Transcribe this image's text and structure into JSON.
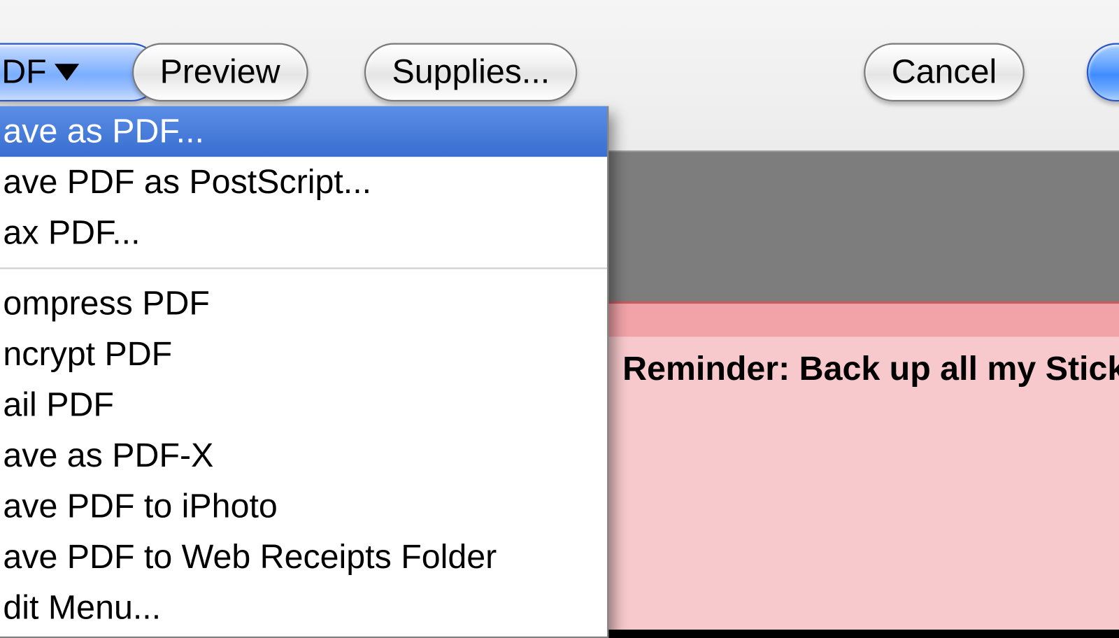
{
  "toolbar": {
    "pdf_label": "DF",
    "preview_label": "Preview",
    "supplies_label": "Supplies...",
    "cancel_label": "Cancel"
  },
  "pdf_menu": {
    "section1": {
      "save_as_pdf": "ave as PDF...",
      "save_as_postscript": "ave PDF as PostScript...",
      "fax_pdf": "ax PDF..."
    },
    "section2": {
      "compress_pdf": "ompress PDF",
      "encrypt_pdf": "ncrypt PDF",
      "mail_pdf": "ail PDF",
      "save_as_pdfx": "ave as PDF-X",
      "save_to_iphoto": "ave PDF to iPhoto",
      "save_to_web_receipts": "ave PDF to Web Receipts Folder",
      "edit_menu": "dit Menu..."
    }
  },
  "note": {
    "text": "Reminder: Back up all my Stick"
  }
}
